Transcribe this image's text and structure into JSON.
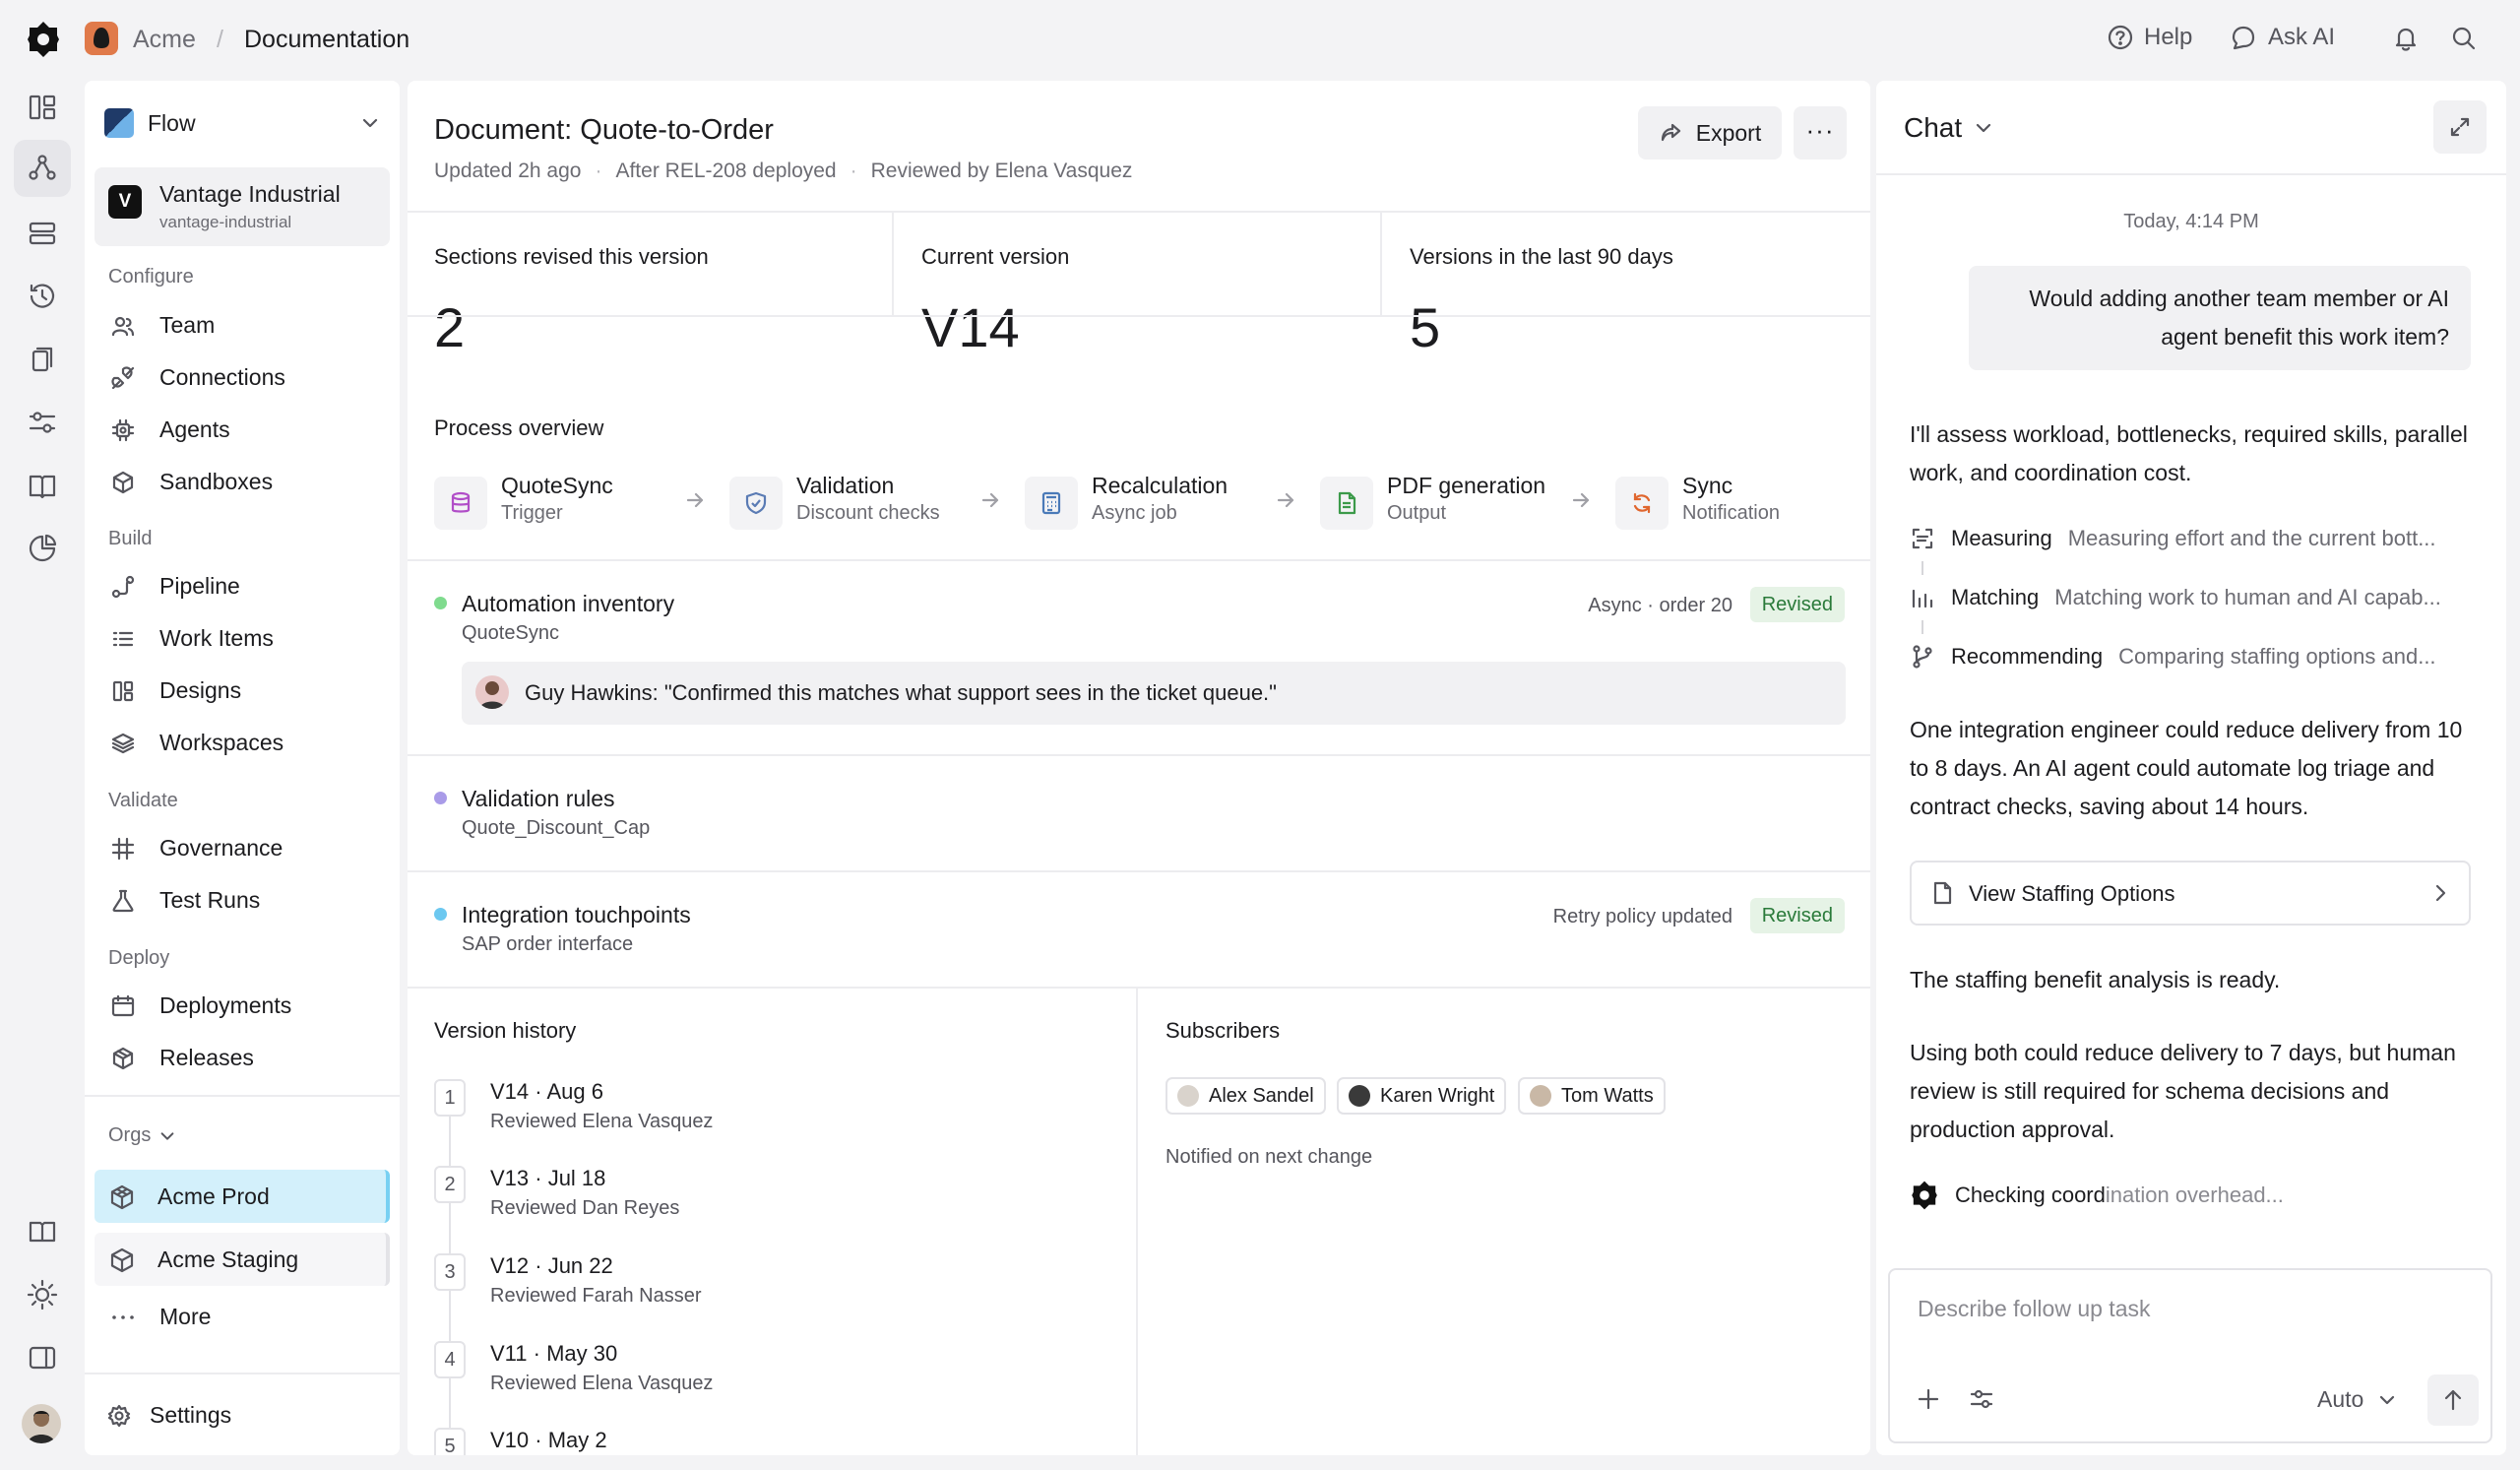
{
  "topbar": {
    "org": "Acme",
    "separator": "/",
    "page": "Documentation",
    "help": "Help",
    "ask_ai": "Ask AI"
  },
  "sidebar": {
    "flow_label": "Flow",
    "account": {
      "badge": "V",
      "name": "Vantage Industrial",
      "slug": "vantage-industrial"
    },
    "sections": {
      "configure": "Configure",
      "build": "Build",
      "validate": "Validate",
      "deploy": "Deploy",
      "orgs": "Orgs"
    },
    "items": {
      "team": "Team",
      "connections": "Connections",
      "agents": "Agents",
      "sandboxes": "Sandboxes",
      "pipeline": "Pipeline",
      "work_items": "Work Items",
      "designs": "Designs",
      "workspaces": "Workspaces",
      "governance": "Governance",
      "test_runs": "Test Runs",
      "deployments": "Deployments",
      "releases": "Releases"
    },
    "orgs": [
      "Acme Prod",
      "Acme Staging"
    ],
    "more": "More",
    "settings": "Settings"
  },
  "document": {
    "title": "Document: Quote-to-Order",
    "meta": [
      "Updated 2h ago",
      "After REL-208 deployed",
      "Reviewed by Elena Vasquez"
    ],
    "meta_sep": "·",
    "export_label": "Export",
    "more_label": "···",
    "stats": [
      {
        "label": "Sections revised this version",
        "value": "2"
      },
      {
        "label": "Current version",
        "value": "V14"
      },
      {
        "label": "Versions in the last 90 days",
        "value": "5"
      }
    ],
    "process_title": "Process overview",
    "steps": [
      {
        "title": "QuoteSync",
        "sub": "Trigger",
        "icon": "database-icon"
      },
      {
        "title": "Validation",
        "sub": "Discount checks",
        "icon": "shield-check-icon"
      },
      {
        "title": "Recalculation",
        "sub": "Async job",
        "icon": "calculator-icon"
      },
      {
        "title": "PDF generation",
        "sub": "Output",
        "icon": "document-icon"
      },
      {
        "title": "Sync",
        "sub": "Notification",
        "icon": "refresh-icon"
      }
    ],
    "items": [
      {
        "title": "Automation inventory",
        "sub": "QuoteSync",
        "meta": "Async · order 20",
        "badge": "Revised",
        "color": "#7fdb8e"
      },
      {
        "title": "Validation rules",
        "sub": "Quote_Discount_Cap",
        "color": "#a99be8"
      },
      {
        "title": "Integration touchpoints",
        "sub": "SAP order interface",
        "meta": "Retry policy updated",
        "badge": "Revised",
        "color": "#6cc8f0"
      }
    ],
    "quote": "Guy Hawkins: \"Confirmed this matches what support sees in the ticket queue.\"",
    "version_history_title": "Version history",
    "versions": [
      {
        "num": "1",
        "title": "V14 · Aug 6",
        "sub": "Reviewed Elena Vasquez"
      },
      {
        "num": "2",
        "title": "V13 · Jul 18",
        "sub": "Reviewed Dan Reyes"
      },
      {
        "num": "3",
        "title": "V12 · Jun 22",
        "sub": "Reviewed Farah Nasser"
      },
      {
        "num": "4",
        "title": "V11 · May 30",
        "sub": "Reviewed Elena Vasquez"
      },
      {
        "num": "5",
        "title": "V10 · May 2",
        "sub": ""
      }
    ],
    "subscribers_title": "Subscribers",
    "subscribers": [
      "Alex Sandel",
      "Karen Wright",
      "Tom Watts"
    ],
    "notified": "Notified on next change"
  },
  "chat": {
    "title": "Chat",
    "timestamp": "Today, 4:14 PM",
    "user_message": "Would adding another team member or AI agent benefit this work item?",
    "intro": "I'll assess workload, bottlenecks, required skills, parallel work, and coordination cost.",
    "steps": [
      {
        "key": "Measuring",
        "desc": "Measuring effort and the current bott...",
        "icon": "scan-icon"
      },
      {
        "key": "Matching",
        "desc": "Matching work to human and AI capab...",
        "icon": "bars-icon"
      },
      {
        "key": "Recommending",
        "desc": "Comparing staffing options and...",
        "icon": "branch-icon"
      }
    ],
    "answer": "One integration engineer could reduce delivery from 10 to 8 days. An AI agent could automate log triage and contract checks, saving about 14 hours.",
    "staffing_button": "View Staffing Options",
    "ready": "The staffing benefit analysis is ready.",
    "followup": "Using both could reduce delivery to 7 days, but human review is still required for schema decisions and production approval.",
    "checking_a": "Checking coord",
    "checking_b": "ination overhead...",
    "input_placeholder": "Describe follow up task",
    "model": "Auto"
  },
  "colors": {
    "accent_org": "#d3f0fb",
    "revised_bg": "#e6f3e6",
    "revised_text": "#2a7a3a"
  }
}
